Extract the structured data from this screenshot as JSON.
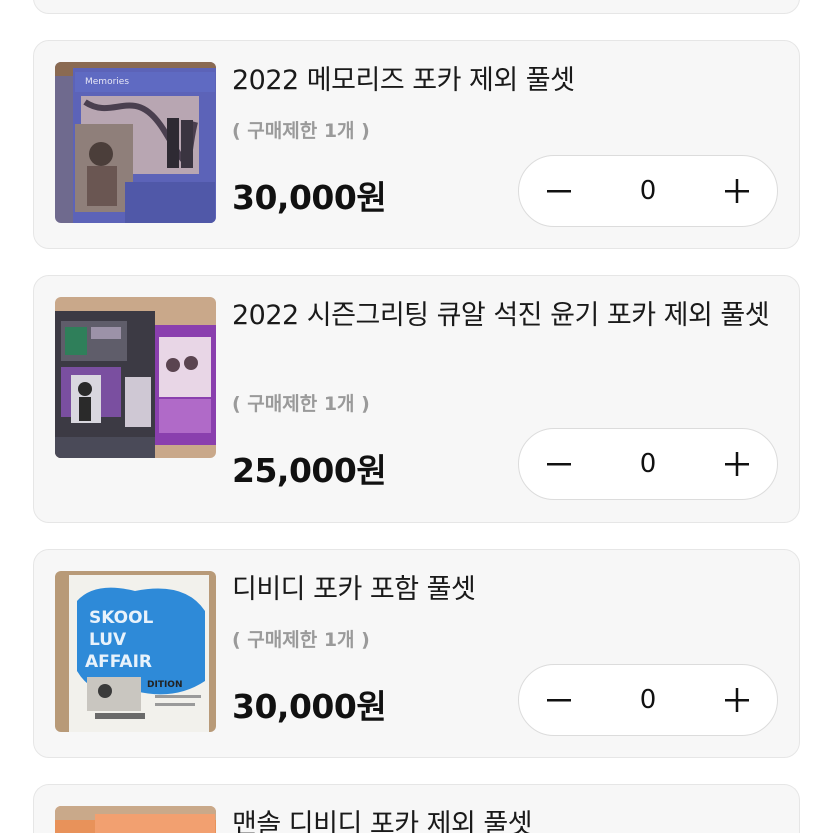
{
  "items": [
    {
      "title": "2022 메모리즈 포카 제외 풀셋",
      "limit": "( 구매제한 1개 )",
      "price": "30,000원",
      "quantity": "0",
      "thumb_label": "Memories"
    },
    {
      "title": "2022 시즌그리팅 큐알 석진 윤기 포카 제외 풀셋",
      "limit": "( 구매제한 1개 )",
      "price": "25,000원",
      "quantity": "0"
    },
    {
      "title": "디비디 포카 포함 풀셋",
      "limit": "( 구매제한 1개 )",
      "price": "30,000원",
      "quantity": "0",
      "thumb_label_1": "SKOOL",
      "thumb_label_2": "LUV",
      "thumb_label_3": "AFFAIR",
      "thumb_label_4": "DITION"
    },
    {
      "title": "맨솔 디비디 포카 제외 풀셋"
    }
  ],
  "icons": {
    "minus": "minus-icon",
    "plus": "plus-icon"
  }
}
